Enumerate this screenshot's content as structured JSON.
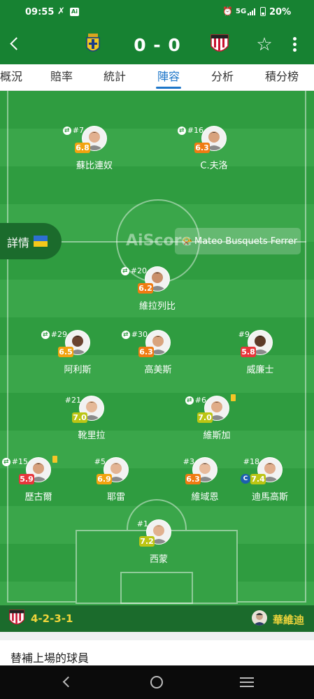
{
  "status_bar": {
    "time": "09:55",
    "network": "5G",
    "battery": "20%",
    "icons": [
      "nfc-icon",
      "ai-icon",
      "alarm-icon",
      "signal-icon",
      "battery-icon"
    ]
  },
  "header": {
    "score": "0 - 0",
    "icons": [
      "back-arrow-icon",
      "home-team-crest",
      "away-team-crest",
      "star-icon",
      "more-icon"
    ]
  },
  "tabs": [
    {
      "label": "概況"
    },
    {
      "label": "賠率"
    },
    {
      "label": "統計"
    },
    {
      "label": "陣容",
      "active": true
    },
    {
      "label": "分析"
    },
    {
      "label": "積分榜"
    }
  ],
  "pitch": {
    "watermark": "AiScore",
    "details_label": "詳情",
    "referee": "Mateo Busquets Ferrer"
  },
  "players": [
    {
      "number": "#7",
      "name": "蘇比連奴",
      "rating": "6.8",
      "rating_color": "#f2a30f",
      "sub": true
    },
    {
      "number": "#16",
      "name": "C.夫洛",
      "rating": "6.3",
      "rating_color": "#f07b12",
      "sub": true
    },
    {
      "number": "#20",
      "name": "維拉列比",
      "rating": "6.2",
      "rating_color": "#f07b12",
      "sub": true
    },
    {
      "number": "#29",
      "name": "阿利斯",
      "rating": "6.5",
      "rating_color": "#f2a30f",
      "sub": true
    },
    {
      "number": "#30",
      "name": "高美斯",
      "rating": "6.3",
      "rating_color": "#f07b12",
      "sub": true
    },
    {
      "number": "#9",
      "name": "威廉士",
      "rating": "5.8",
      "rating_color": "#e8363c",
      "sub": false
    },
    {
      "number": "#21",
      "name": "靴里拉",
      "rating": "7.0",
      "rating_color": "#bcc514",
      "sub": false
    },
    {
      "number": "#6",
      "name": "維斯加",
      "rating": "7.0",
      "rating_color": "#bcc514",
      "sub": true,
      "yellow_card": true
    },
    {
      "number": "#15",
      "name": "歷古爾",
      "rating": "5.9",
      "rating_color": "#e8363c",
      "sub": true,
      "yellow_card": true
    },
    {
      "number": "#5",
      "name": "耶雷",
      "rating": "6.9",
      "rating_color": "#f2a30f",
      "sub": false
    },
    {
      "number": "#3",
      "name": "維域恩",
      "rating": "6.3",
      "rating_color": "#f07b12",
      "sub": false
    },
    {
      "number": "#18",
      "name": "迪馬高斯",
      "rating": "7.4",
      "rating_color": "#bcc514",
      "sub": false,
      "captain": true
    },
    {
      "number": "#1",
      "name": "西蒙",
      "rating": "7.2",
      "rating_color": "#bcc514",
      "sub": false
    }
  ],
  "captain_label": "C",
  "sub_glyph": "⇄",
  "formation": {
    "value": "4-2-3-1",
    "coach": "華維迪"
  },
  "subs_header": "替補上場的球員",
  "colors": {
    "header_green": "#178232",
    "accent_blue": "#1d76c9",
    "formation_yellow": "#f0d53b"
  }
}
